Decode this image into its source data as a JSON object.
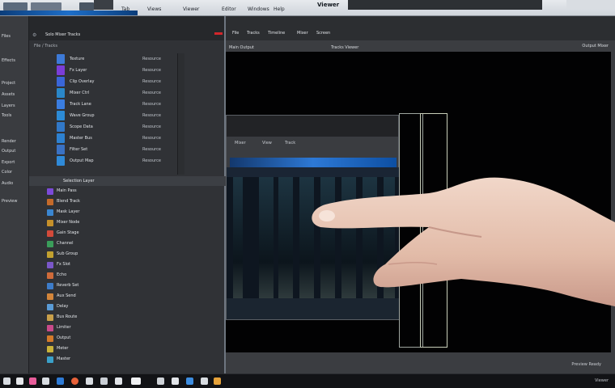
{
  "menubar": {
    "items": [
      "Tab",
      "Views",
      "Viewer",
      "Editor",
      "Windows",
      "Help"
    ],
    "app_title": "Viewer"
  },
  "left_panel": {
    "rows": [
      "Files",
      "Effects",
      "Project",
      "Assets",
      "Layers",
      "Tools",
      "Render",
      "Output",
      "Export",
      "Color",
      "Audio",
      "Preview"
    ]
  },
  "browser": {
    "header": "Solo Mixer Tracks",
    "path": "File / Tracks",
    "files": [
      {
        "name": "Texture",
        "type": "Resource",
        "color": "#3d7ad8"
      },
      {
        "name": "Fx Layer",
        "type": "Resource",
        "color": "#7b3dd8"
      },
      {
        "name": "Clip Overlay",
        "type": "Resource",
        "color": "#3a66d9"
      },
      {
        "name": "Mixer Ctrl",
        "type": "Resource",
        "color": "#2a87c9"
      },
      {
        "name": "Track Lane",
        "type": "Resource",
        "color": "#3a7de0"
      },
      {
        "name": "Wave Group",
        "type": "Resource",
        "color": "#2c8bd6"
      },
      {
        "name": "Scope Data",
        "type": "Resource",
        "color": "#3178c8"
      },
      {
        "name": "Master Bus",
        "type": "Resource",
        "color": "#2d81d1"
      },
      {
        "name": "Filter Set",
        "type": "Resource",
        "color": "#3a72c4"
      },
      {
        "name": "Output Map",
        "type": "Resource",
        "color": "#2f8ad8"
      }
    ],
    "selected": "Selection Layer",
    "layers": [
      {
        "name": "Main Pass",
        "color": "#7c4ad9"
      },
      {
        "name": "Blend Track",
        "color": "#c46a2a"
      },
      {
        "name": "Mask Layer",
        "color": "#3a86d1"
      },
      {
        "name": "Mixer Node",
        "color": "#c6902a"
      },
      {
        "name": "Gain Stage",
        "color": "#d34a3a"
      },
      {
        "name": "Channel",
        "color": "#3a9d5a"
      },
      {
        "name": "Sub Group",
        "color": "#c2a12f"
      },
      {
        "name": "Fx Slot",
        "color": "#7a57c8"
      },
      {
        "name": "Echo",
        "color": "#cf6b3a"
      },
      {
        "name": "Reverb Set",
        "color": "#3d7cc9"
      },
      {
        "name": "Aux Send",
        "color": "#d3853a"
      },
      {
        "name": "Delay",
        "color": "#5a9bd6"
      },
      {
        "name": "Bus Route",
        "color": "#c9a04a"
      },
      {
        "name": "Limiter",
        "color": "#c94a8a"
      },
      {
        "name": "Output",
        "color": "#d37a2a"
      },
      {
        "name": "Meter",
        "color": "#c9b23a"
      },
      {
        "name": "Master",
        "color": "#3aa0c9"
      }
    ]
  },
  "viewer": {
    "tabs": [
      "File",
      "Tracks",
      "Timeline",
      "Mixer",
      "Screen"
    ],
    "title": "Main Output",
    "center_label": "Tracks Viewer",
    "right_label": "Output Mixer",
    "footer": "Preview Ready"
  },
  "inner_window": {
    "menu": [
      "Mixer",
      "View",
      "Track"
    ]
  },
  "taskbar": {
    "tray_text": "Viewer"
  }
}
